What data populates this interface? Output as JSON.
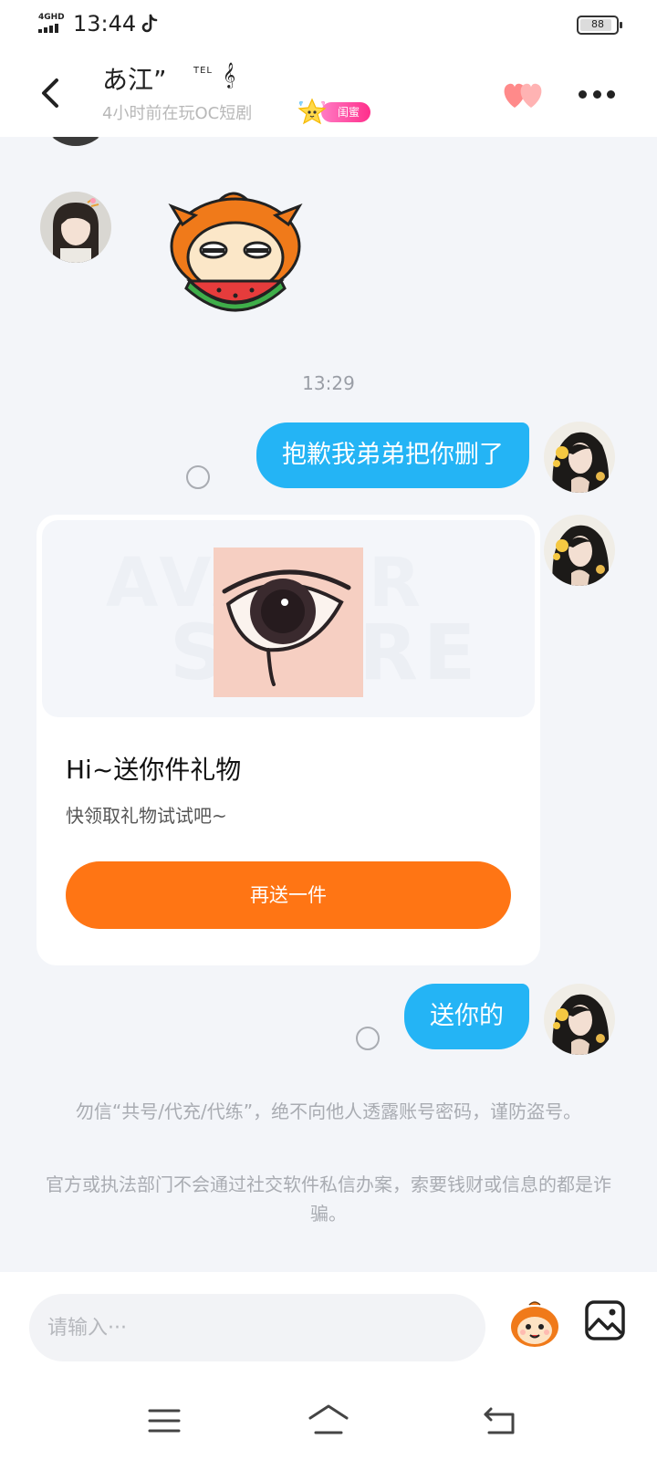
{
  "status_bar": {
    "network": "4GHD",
    "time": "13:44",
    "battery": "88"
  },
  "header": {
    "contact_name": "あ江”",
    "name_tel": "TEL",
    "name_symbol": "𝄞",
    "last_seen": "4小时前在玩OC短剧",
    "badge_label": "闺蜜"
  },
  "chat": {
    "timestamp": "13:29",
    "messages": [
      {
        "text": "抱歉我弟弟把你删了"
      },
      {
        "text": "送你的"
      }
    ],
    "gift_card": {
      "watermark_line1": "AVATAR",
      "watermark_line2": "STORE",
      "title": "Hi~送你件礼物",
      "subtitle": "快领取礼物试试吧~",
      "button_label": "再送一件"
    },
    "notices": [
      "勿信“共号/代充/代练”，绝不向他人透露账号密码，谨防盗号。",
      "官方或执法部门不会通过社交软件私信办案，索要钱财或信息的都是诈骗。"
    ]
  },
  "input_bar": {
    "placeholder": "请输入···"
  },
  "colors": {
    "bubble": "#24b4f5",
    "gift_button": "#ff7514",
    "badge": "#ff2f8b"
  }
}
